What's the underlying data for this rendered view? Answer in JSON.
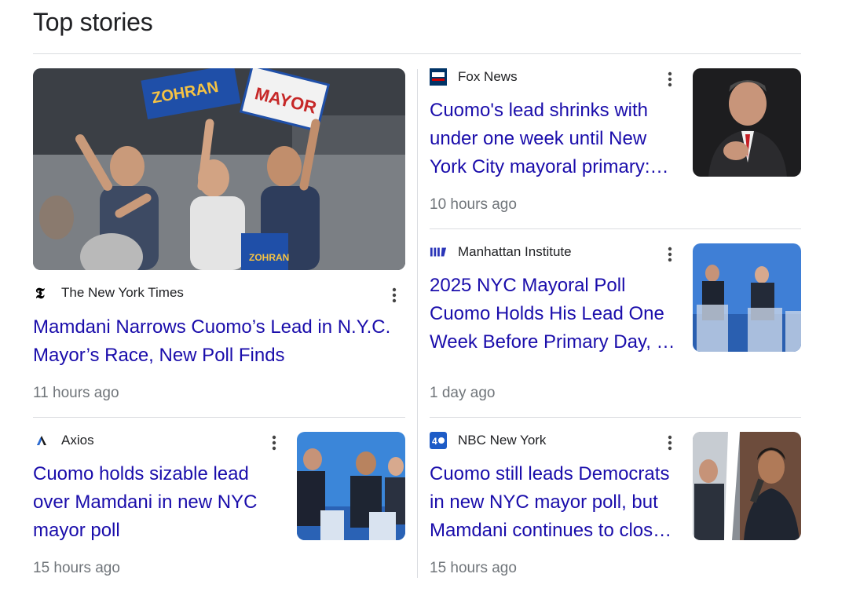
{
  "heading": "Top stories",
  "stories": [
    {
      "source": "The New York Times",
      "title": "Mamdani Narrows Cuomo’s Lead in N.Y.C. Mayor’s Race, New Poll Finds",
      "time": "11 hours ago",
      "image_signs": [
        "ZOHRAN",
        "MAYOR",
        "ZOHRAN"
      ]
    },
    {
      "source": "Fox News",
      "title": "Cuomo's lead shrinks with under one week until New York City mayoral primary:…",
      "time": "10 hours ago"
    },
    {
      "source": "Manhattan Institute",
      "title": "2025 NYC Mayoral Poll Cuomo Holds His Lead One Week Before Primary Day, …",
      "time": "1 day ago"
    },
    {
      "source": "Axios",
      "title": "Cuomo holds sizable lead over Mamdani in new NYC mayor poll",
      "time": "15 hours ago"
    },
    {
      "source": "NBC New York",
      "title": "Cuomo still leads Democrats in new NYC mayor poll, but Mamdani continues to clos…",
      "time": "15 hours ago"
    }
  ],
  "icons": {
    "nyt": "nyt-logo-icon",
    "fox": "fox-news-logo-icon",
    "mi": "manhattan-institute-logo-icon",
    "axios": "axios-logo-icon",
    "nbc": "nbc-new-york-logo-icon",
    "more": "more-vert-icon"
  },
  "colors": {
    "link": "#1a0dab",
    "meta": "#70757a",
    "divider": "#dadce0"
  }
}
